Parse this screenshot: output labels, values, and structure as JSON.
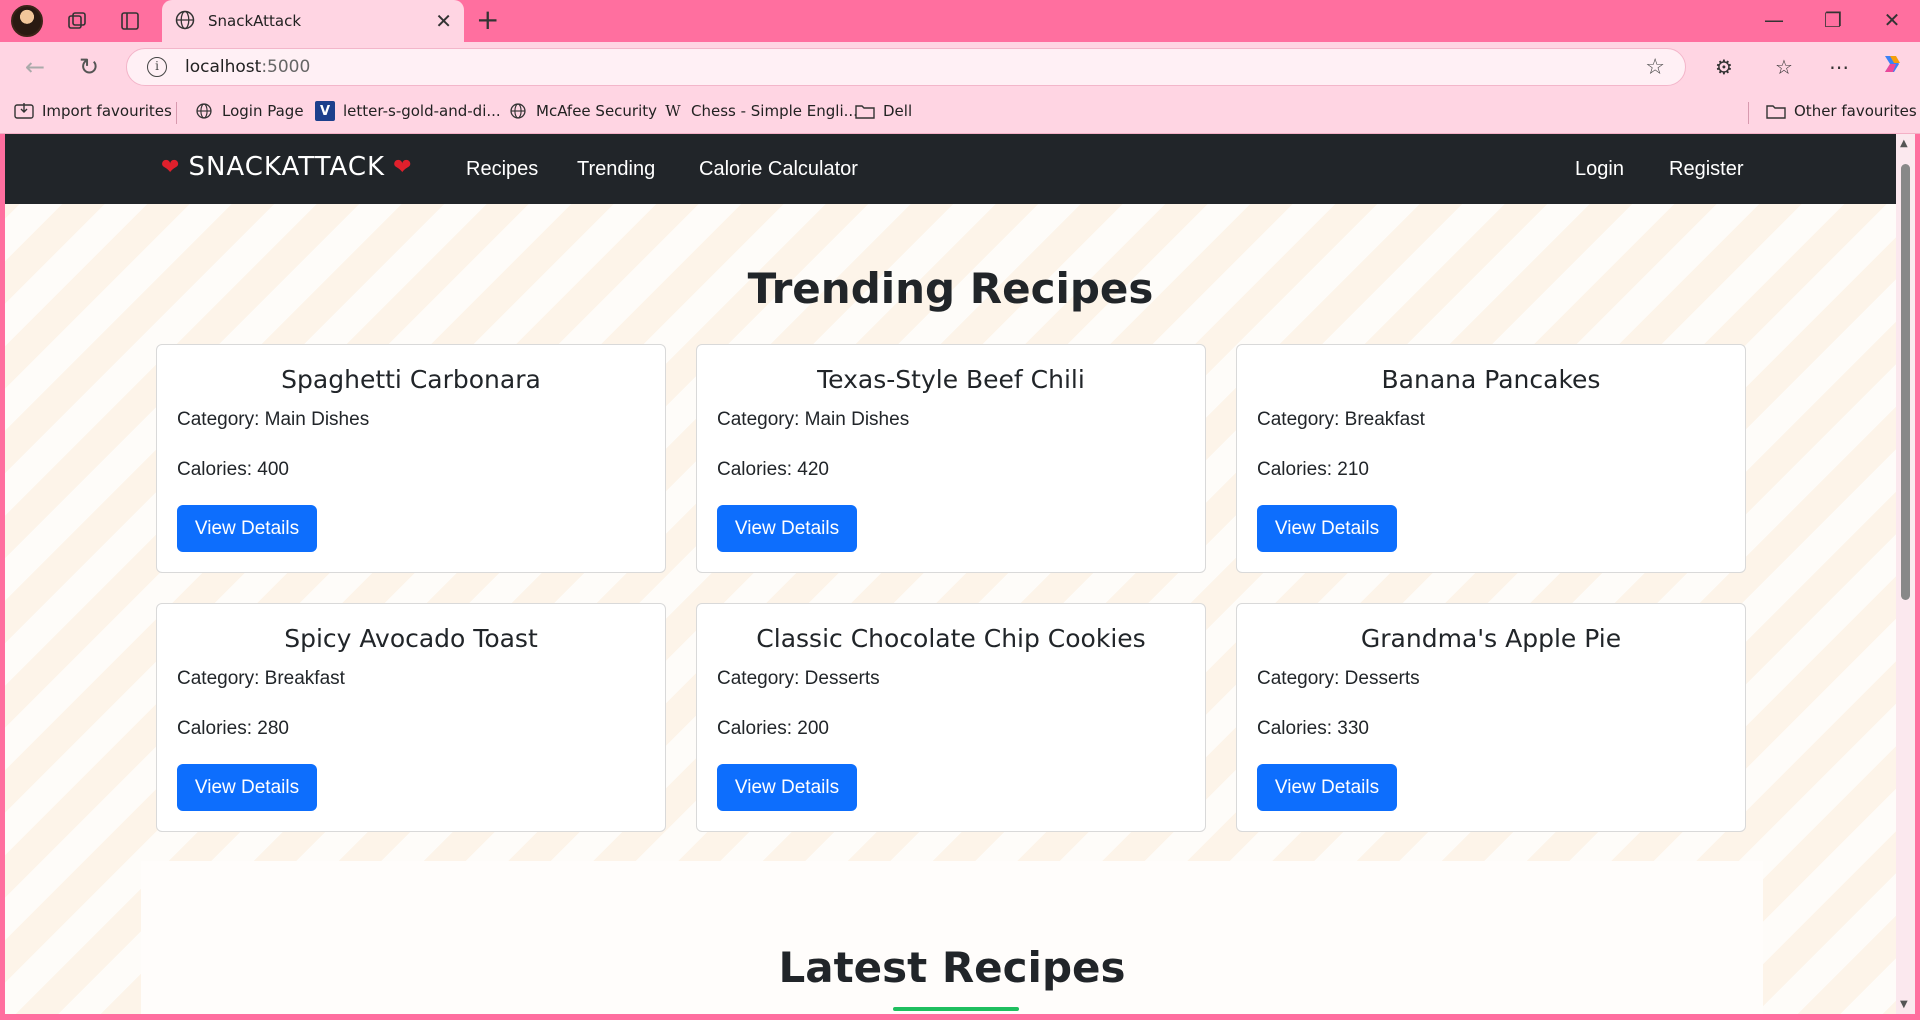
{
  "browser": {
    "tab_title": "SnackAttack",
    "url_host": "localhost",
    "url_port": ":5000",
    "accent_color": "#ff6f9f",
    "bookmarks": [
      {
        "label": "Import favourites",
        "icon": "import-icon"
      },
      {
        "label": "Login Page",
        "icon": "globe-icon"
      },
      {
        "label": "letter-s-gold-and-di...",
        "icon": "vector-logo-icon"
      },
      {
        "label": "McAfee Security",
        "icon": "globe-icon"
      },
      {
        "label": "Chess - Simple Engli...",
        "icon": "wikipedia-icon"
      },
      {
        "label": "Dell",
        "icon": "folder-icon"
      }
    ],
    "other_favourites": "Other favourites"
  },
  "navbar": {
    "brand": "SNACKATTACK",
    "links": [
      "Recipes",
      "Trending",
      "Calorie Calculator"
    ],
    "login": "Login",
    "register": "Register"
  },
  "trending": {
    "title": "Trending Recipes",
    "cards": [
      {
        "name": "Spaghetti Carbonara",
        "category": "Category: Main Dishes",
        "calories": "Calories: 400",
        "button": "View Details"
      },
      {
        "name": "Texas-Style Beef Chili",
        "category": "Category: Main Dishes",
        "calories": "Calories: 420",
        "button": "View Details"
      },
      {
        "name": "Banana Pancakes",
        "category": "Category: Breakfast",
        "calories": "Calories: 210",
        "button": "View Details"
      },
      {
        "name": "Spicy Avocado Toast",
        "category": "Category: Breakfast",
        "calories": "Calories: 280",
        "button": "View Details"
      },
      {
        "name": "Classic Chocolate Chip Cookies",
        "category": "Category: Desserts",
        "calories": "Calories: 200",
        "button": "View Details"
      },
      {
        "name": "Grandma's Apple Pie",
        "category": "Category: Desserts",
        "calories": "Calories: 330",
        "button": "View Details"
      }
    ]
  },
  "latest": {
    "title": "Latest Recipes"
  },
  "colors": {
    "button_primary": "#0d6efd",
    "navbar_bg": "#212529",
    "underline_accent": "#1fbf5f"
  }
}
